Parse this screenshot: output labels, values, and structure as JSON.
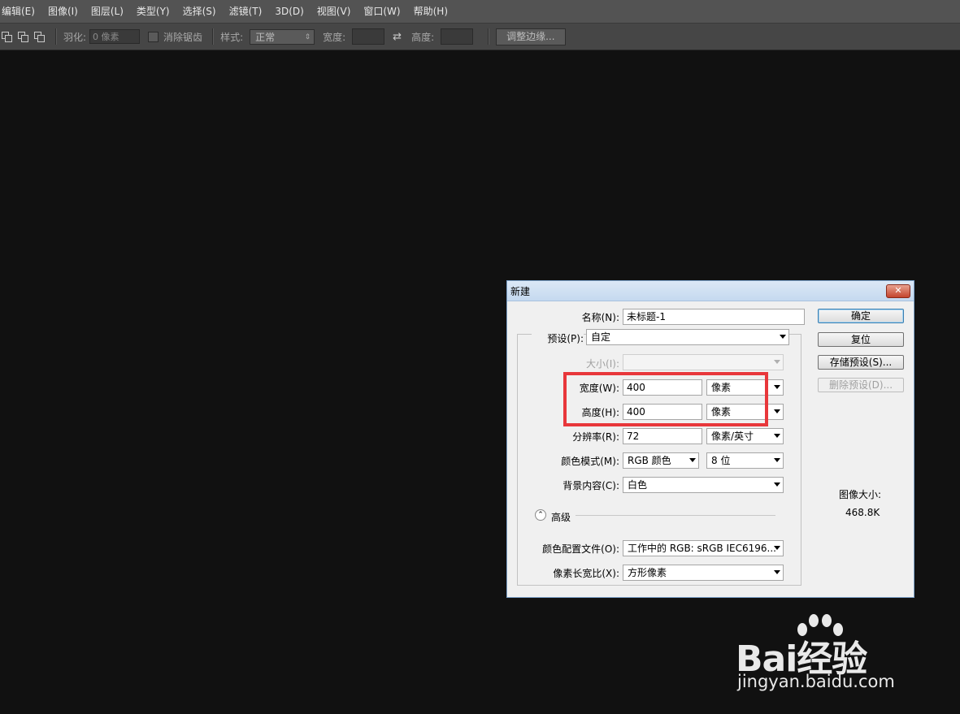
{
  "menubar": {
    "items": [
      "编辑(E)",
      "图像(I)",
      "图层(L)",
      "类型(Y)",
      "选择(S)",
      "滤镜(T)",
      "3D(D)",
      "视图(V)",
      "窗口(W)",
      "帮助(H)"
    ]
  },
  "options_bar": {
    "feather_label": "羽化:",
    "feather_value": "0 像素",
    "antialias_label": "消除锯齿",
    "style_label": "样式:",
    "style_value": "正常",
    "width_label": "宽度:",
    "height_label": "高度:",
    "refine_edge_button": "调整边缘..."
  },
  "dialog": {
    "title": "新建",
    "close_glyph": "✕",
    "name_label": "名称(N):",
    "name_value": "未标题-1",
    "preset_label": "预设(P):",
    "preset_value": "自定",
    "size_label": "大小(I):",
    "size_value": "",
    "width_label": "宽度(W):",
    "width_value": "400",
    "width_unit": "像素",
    "height_label": "高度(H):",
    "height_value": "400",
    "height_unit": "像素",
    "resolution_label": "分辨率(R):",
    "resolution_value": "72",
    "resolution_unit": "像素/英寸",
    "color_mode_label": "颜色模式(M):",
    "color_mode_value": "RGB 颜色",
    "bit_depth_value": "8 位",
    "background_label": "背景内容(C):",
    "background_value": "白色",
    "advanced_label": "高级",
    "advanced_glyph": "⌃",
    "color_profile_label": "颜色配置文件(O):",
    "color_profile_value": "工作中的 RGB: sRGB IEC6196...",
    "pixel_aspect_label": "像素长宽比(X):",
    "pixel_aspect_value": "方形像素",
    "ok_button": "确定",
    "reset_button": "复位",
    "save_preset_button": "存储预设(S)...",
    "delete_preset_button": "删除预设(D)...",
    "image_size_label": "图像大小:",
    "image_size_value": "468.8K"
  },
  "watermark": {
    "logo": "Bai经验",
    "url": "jingyan.baidu.com"
  },
  "colors": {
    "highlight": "#e8373b",
    "canvas": "#111111",
    "menubar": "#535353"
  }
}
